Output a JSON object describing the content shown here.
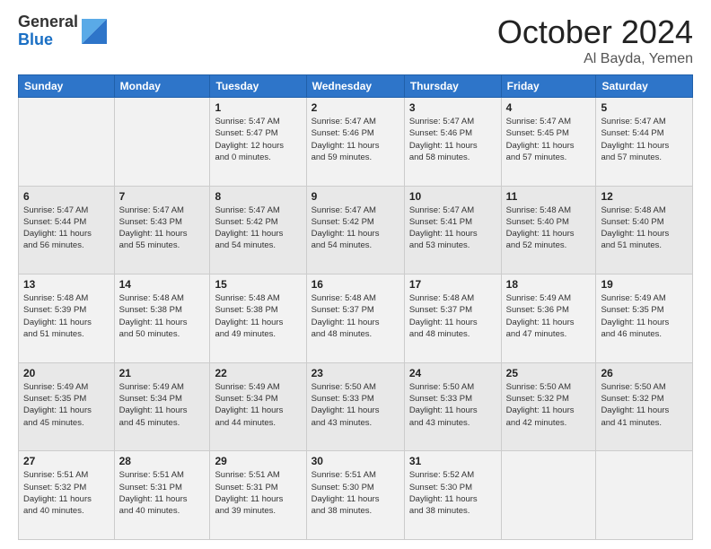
{
  "header": {
    "logo_general": "General",
    "logo_blue": "Blue",
    "month_title": "October 2024",
    "location": "Al Bayda, Yemen"
  },
  "days_of_week": [
    "Sunday",
    "Monday",
    "Tuesday",
    "Wednesday",
    "Thursday",
    "Friday",
    "Saturday"
  ],
  "weeks": [
    [
      {
        "day": "",
        "info": ""
      },
      {
        "day": "",
        "info": ""
      },
      {
        "day": "1",
        "info": "Sunrise: 5:47 AM\nSunset: 5:47 PM\nDaylight: 12 hours\nand 0 minutes."
      },
      {
        "day": "2",
        "info": "Sunrise: 5:47 AM\nSunset: 5:46 PM\nDaylight: 11 hours\nand 59 minutes."
      },
      {
        "day": "3",
        "info": "Sunrise: 5:47 AM\nSunset: 5:46 PM\nDaylight: 11 hours\nand 58 minutes."
      },
      {
        "day": "4",
        "info": "Sunrise: 5:47 AM\nSunset: 5:45 PM\nDaylight: 11 hours\nand 57 minutes."
      },
      {
        "day": "5",
        "info": "Sunrise: 5:47 AM\nSunset: 5:44 PM\nDaylight: 11 hours\nand 57 minutes."
      }
    ],
    [
      {
        "day": "6",
        "info": "Sunrise: 5:47 AM\nSunset: 5:44 PM\nDaylight: 11 hours\nand 56 minutes."
      },
      {
        "day": "7",
        "info": "Sunrise: 5:47 AM\nSunset: 5:43 PM\nDaylight: 11 hours\nand 55 minutes."
      },
      {
        "day": "8",
        "info": "Sunrise: 5:47 AM\nSunset: 5:42 PM\nDaylight: 11 hours\nand 54 minutes."
      },
      {
        "day": "9",
        "info": "Sunrise: 5:47 AM\nSunset: 5:42 PM\nDaylight: 11 hours\nand 54 minutes."
      },
      {
        "day": "10",
        "info": "Sunrise: 5:47 AM\nSunset: 5:41 PM\nDaylight: 11 hours\nand 53 minutes."
      },
      {
        "day": "11",
        "info": "Sunrise: 5:48 AM\nSunset: 5:40 PM\nDaylight: 11 hours\nand 52 minutes."
      },
      {
        "day": "12",
        "info": "Sunrise: 5:48 AM\nSunset: 5:40 PM\nDaylight: 11 hours\nand 51 minutes."
      }
    ],
    [
      {
        "day": "13",
        "info": "Sunrise: 5:48 AM\nSunset: 5:39 PM\nDaylight: 11 hours\nand 51 minutes."
      },
      {
        "day": "14",
        "info": "Sunrise: 5:48 AM\nSunset: 5:38 PM\nDaylight: 11 hours\nand 50 minutes."
      },
      {
        "day": "15",
        "info": "Sunrise: 5:48 AM\nSunset: 5:38 PM\nDaylight: 11 hours\nand 49 minutes."
      },
      {
        "day": "16",
        "info": "Sunrise: 5:48 AM\nSunset: 5:37 PM\nDaylight: 11 hours\nand 48 minutes."
      },
      {
        "day": "17",
        "info": "Sunrise: 5:48 AM\nSunset: 5:37 PM\nDaylight: 11 hours\nand 48 minutes."
      },
      {
        "day": "18",
        "info": "Sunrise: 5:49 AM\nSunset: 5:36 PM\nDaylight: 11 hours\nand 47 minutes."
      },
      {
        "day": "19",
        "info": "Sunrise: 5:49 AM\nSunset: 5:35 PM\nDaylight: 11 hours\nand 46 minutes."
      }
    ],
    [
      {
        "day": "20",
        "info": "Sunrise: 5:49 AM\nSunset: 5:35 PM\nDaylight: 11 hours\nand 45 minutes."
      },
      {
        "day": "21",
        "info": "Sunrise: 5:49 AM\nSunset: 5:34 PM\nDaylight: 11 hours\nand 45 minutes."
      },
      {
        "day": "22",
        "info": "Sunrise: 5:49 AM\nSunset: 5:34 PM\nDaylight: 11 hours\nand 44 minutes."
      },
      {
        "day": "23",
        "info": "Sunrise: 5:50 AM\nSunset: 5:33 PM\nDaylight: 11 hours\nand 43 minutes."
      },
      {
        "day": "24",
        "info": "Sunrise: 5:50 AM\nSunset: 5:33 PM\nDaylight: 11 hours\nand 43 minutes."
      },
      {
        "day": "25",
        "info": "Sunrise: 5:50 AM\nSunset: 5:32 PM\nDaylight: 11 hours\nand 42 minutes."
      },
      {
        "day": "26",
        "info": "Sunrise: 5:50 AM\nSunset: 5:32 PM\nDaylight: 11 hours\nand 41 minutes."
      }
    ],
    [
      {
        "day": "27",
        "info": "Sunrise: 5:51 AM\nSunset: 5:32 PM\nDaylight: 11 hours\nand 40 minutes."
      },
      {
        "day": "28",
        "info": "Sunrise: 5:51 AM\nSunset: 5:31 PM\nDaylight: 11 hours\nand 40 minutes."
      },
      {
        "day": "29",
        "info": "Sunrise: 5:51 AM\nSunset: 5:31 PM\nDaylight: 11 hours\nand 39 minutes."
      },
      {
        "day": "30",
        "info": "Sunrise: 5:51 AM\nSunset: 5:30 PM\nDaylight: 11 hours\nand 38 minutes."
      },
      {
        "day": "31",
        "info": "Sunrise: 5:52 AM\nSunset: 5:30 PM\nDaylight: 11 hours\nand 38 minutes."
      },
      {
        "day": "",
        "info": ""
      },
      {
        "day": "",
        "info": ""
      }
    ]
  ]
}
